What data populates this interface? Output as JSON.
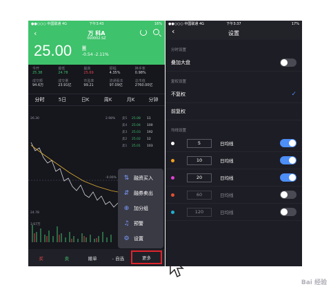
{
  "left": {
    "status": {
      "carrier": "●●○○○ 中国联通 4G",
      "time": "下午3:43",
      "battery": "16%"
    },
    "stock": {
      "name": "万 科A",
      "code": "000002.SZ",
      "price": "25.00",
      "badge": "融",
      "change": "-0.54  -2.11%"
    },
    "stats": [
      {
        "k": "今开",
        "v": "25.38",
        "tone": "green"
      },
      {
        "k": "最低",
        "v": "24.78",
        "tone": "green"
      },
      {
        "k": "最高",
        "v": "25.69",
        "tone": "red"
      },
      {
        "k": "振幅",
        "v": "4.35%",
        "tone": ""
      },
      {
        "k": "换手率",
        "v": "0.98%",
        "tone": ""
      },
      {
        "k": "成交额",
        "v": "94.6万",
        "tone": ""
      },
      {
        "k": "成交量",
        "v": "23.91亿",
        "tone": ""
      },
      {
        "k": "市盈率",
        "v": "99.21",
        "tone": ""
      },
      {
        "k": "流通股本",
        "v": "97.09亿",
        "tone": ""
      },
      {
        "k": "总市值",
        "v": "2760.00亿",
        "tone": ""
      }
    ],
    "tabs": [
      "分时",
      "5日",
      "日K",
      "周K",
      "月K",
      "分钟"
    ],
    "axis": {
      "top": "26.30",
      "pct_top": "2.98%",
      "mid_pct": "-0.00%",
      "low": "24.78",
      "vol": "3.67万"
    },
    "orderbook": [
      {
        "n": "卖5",
        "p": "25.08",
        "q": "11"
      },
      {
        "n": "卖4",
        "p": "25.04",
        "q": "100"
      },
      {
        "n": "卖3",
        "p": "25.03",
        "q": "192"
      },
      {
        "n": "卖2",
        "p": "25.02",
        "q": "12"
      },
      {
        "n": "卖1",
        "p": "25.01",
        "q": "103"
      }
    ],
    "popup": [
      {
        "label": "融资买入",
        "icon": "⇅"
      },
      {
        "label": "融券卖出",
        "icon": "⇵"
      },
      {
        "label": "加分组",
        "icon": "⊕"
      },
      {
        "label": "预警",
        "icon": "♫"
      },
      {
        "label": "设置",
        "icon": "⚙"
      }
    ],
    "bottom": {
      "buy": "买",
      "sell": "卖",
      "cancel": "撤单",
      "watch": "- 自选",
      "more": "更多"
    }
  },
  "right": {
    "status": {
      "carrier": "●●○○○ 中国联通 4G",
      "time": "下午3:37",
      "battery": "17%"
    },
    "title": "设置",
    "sec_timeshare": "分时设置",
    "overlay_label": "叠加大盘",
    "sec_adjust": "复权设置",
    "no_adjust": "不复权",
    "fwd_adjust": "前复权",
    "sec_ma": "均线设置",
    "ma": [
      {
        "value": "5",
        "unit": "日均线",
        "color": "#ffffff",
        "on": true
      },
      {
        "value": "10",
        "unit": "日均线",
        "color": "#f0a020",
        "on": true
      },
      {
        "value": "20",
        "unit": "日均线",
        "color": "#e040d0",
        "on": true
      },
      {
        "value": "60",
        "unit": "日均线",
        "color": "#e05030",
        "on": false
      },
      {
        "value": "120",
        "unit": "日均线",
        "color": "#20b0d0",
        "on": false
      }
    ]
  },
  "watermark": "Bai 经验"
}
